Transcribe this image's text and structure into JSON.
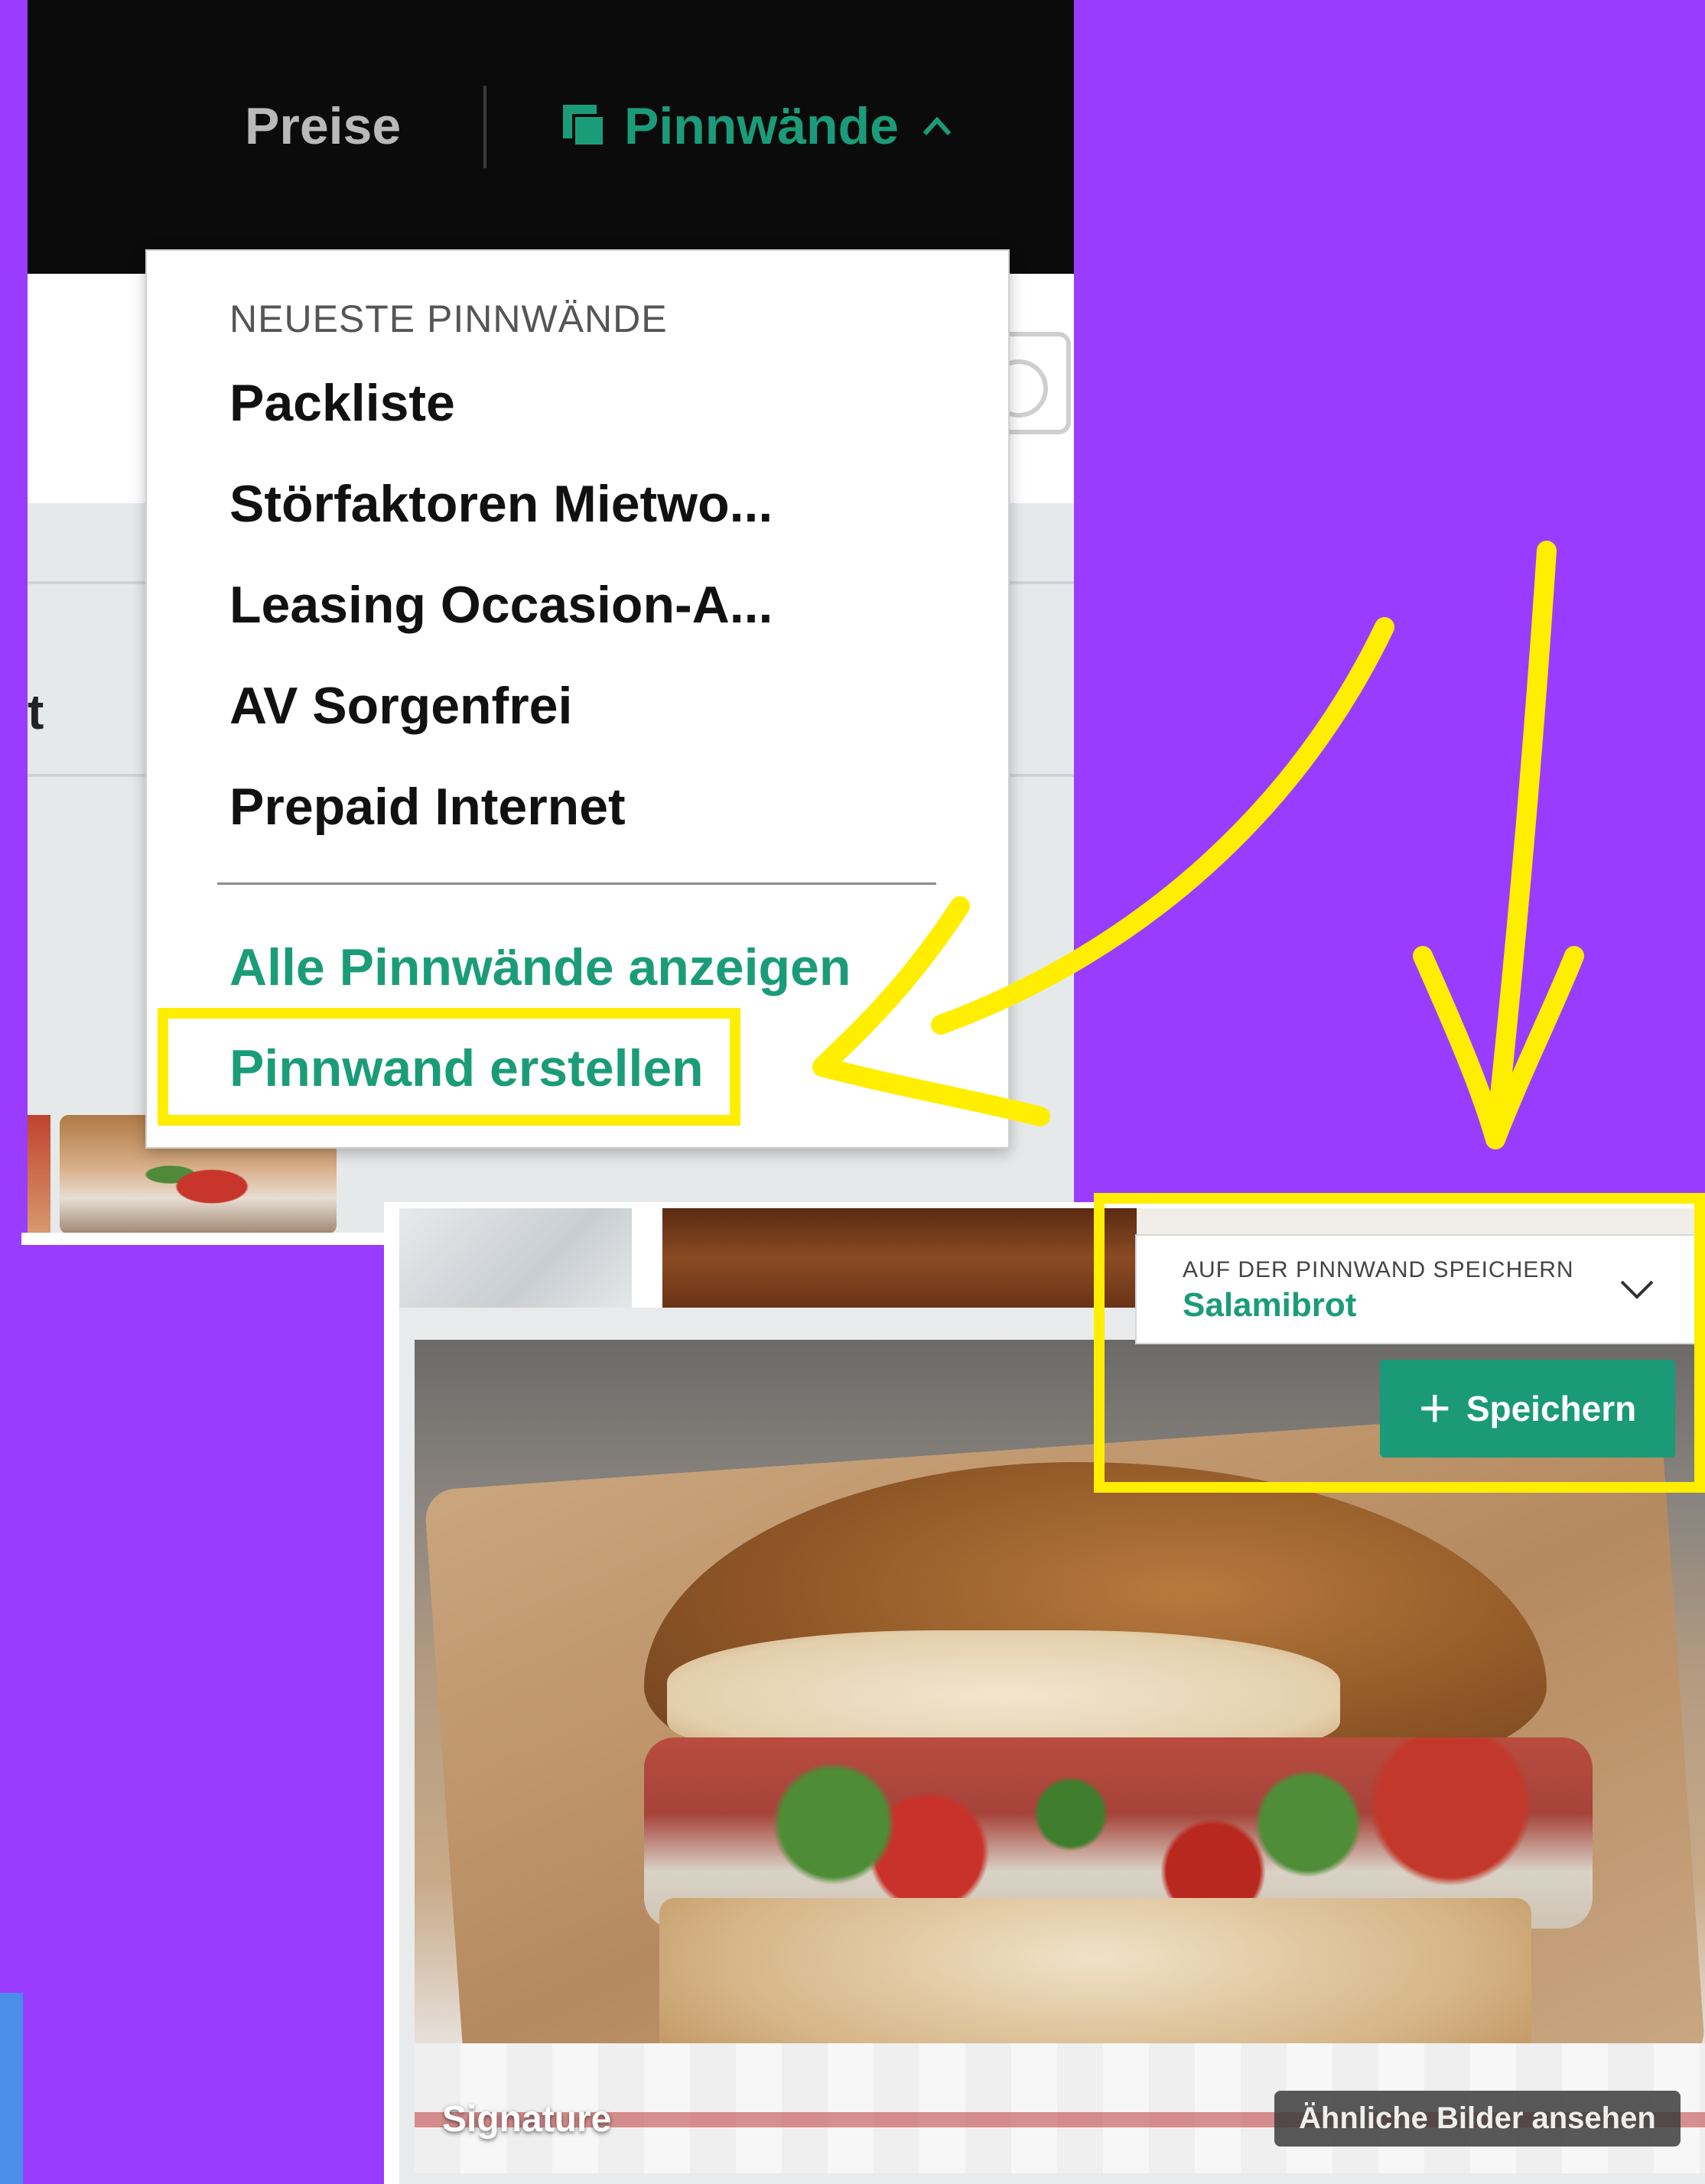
{
  "colors": {
    "background": "#9a3cff",
    "accent_green": "#1b9c79",
    "highlight_yellow": "#ffee00"
  },
  "nav": {
    "prices": "Preise",
    "boards": "Pinnwände",
    "boards_icon": "board-icon",
    "boards_chevron": "chevron-up-icon"
  },
  "side_text": "t",
  "dropdown": {
    "heading": "NEUESTE PINNWÄNDE",
    "items": [
      "Packliste",
      "Störfaktoren Mietwo...",
      "Leasing Occasion-A...",
      "AV Sorgenfrei",
      "Prepaid Internet"
    ],
    "show_all": "Alle Pinnwände anzeigen",
    "create": "Pinnwand erstellen"
  },
  "save_widget": {
    "label": "AUF DER PINNWAND SPEICHERN",
    "value": "Salamibrot",
    "button": "Speichern",
    "button_icon": "plus-icon"
  },
  "photo": {
    "caption": "Signature",
    "similar_button": "Ähnliche Bilder ansehen"
  }
}
